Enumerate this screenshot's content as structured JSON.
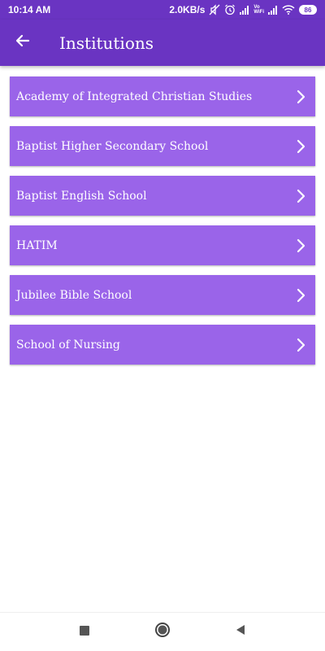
{
  "status_bar": {
    "time": "10:14 AM",
    "network_speed": "2.0KB/s",
    "volte_top": "Vo",
    "volte_bottom": "WiFi",
    "battery": "86",
    "icons": [
      "mute-icon",
      "alarm-icon",
      "signal-icon",
      "volte-icon",
      "signal-icon",
      "wifi-icon",
      "battery-icon"
    ]
  },
  "app_bar": {
    "title": "Institutions",
    "back_icon": "arrow-left-icon"
  },
  "institutions": [
    {
      "label": "Academy of Integrated Christian Studies"
    },
    {
      "label": "Baptist Higher Secondary School"
    },
    {
      "label": "Baptist English School"
    },
    {
      "label": "HATIM"
    },
    {
      "label": "Jubilee Bible School"
    },
    {
      "label": "School of Nursing"
    }
  ],
  "nav_bar": {
    "icons": [
      "recents-square-icon",
      "home-circle-icon",
      "back-triangle-icon"
    ]
  },
  "colors": {
    "primary": "#6a34c2",
    "list_item": "#9a64e9",
    "text_on_primary": "#ffffff"
  }
}
